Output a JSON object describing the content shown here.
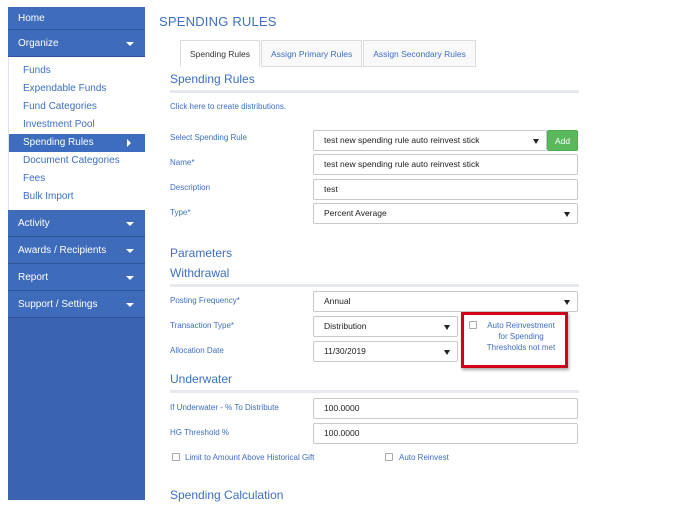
{
  "sidebar": {
    "home": "Home",
    "organize": "Organize",
    "organize_items": [
      "Funds",
      "Expendable Funds",
      "Fund Categories",
      "Investment Pool",
      "Spending Rules",
      "Document Categories",
      "Fees",
      "Bulk Import"
    ],
    "activity": "Activity",
    "awards": "Awards / Recipients",
    "report": "Report",
    "support": "Support / Settings"
  },
  "page": {
    "title": "SPENDING RULES"
  },
  "tabs": [
    "Spending Rules",
    "Assign Primary Rules",
    "Assign Secondary Rules"
  ],
  "spending_rules": {
    "heading": "Spending Rules",
    "create_link": "Click here to create distributions.",
    "select_label": "Select Spending Rule",
    "select_value": "test new spending rule auto reinvest stick",
    "add_button": "Add",
    "name_label": "Name*",
    "name_value": "test new spending rule auto reinvest stick",
    "description_label": "Description",
    "description_value": "test",
    "type_label": "Type*",
    "type_value": "Percent Average"
  },
  "parameters": {
    "heading": "Parameters"
  },
  "withdrawal": {
    "heading": "Withdrawal",
    "posting_frequency_label": "Posting Frequency*",
    "posting_frequency_value": "Annual",
    "transaction_type_label": "Transaction Type*",
    "transaction_type_value": "Distribution",
    "allocation_date_label": "Allocation Date",
    "allocation_date_value": "11/30/2019",
    "auto_reinvest_label": "Auto Reinvestment for Spending Thresholds not met"
  },
  "underwater": {
    "heading": "Underwater",
    "pct_label": "If Underwater - % To Distribute",
    "pct_value": "100.0000",
    "hg_label": "HG Threshold %",
    "hg_value": "100.0000",
    "limit_label": "Limit to Amount Above Historical Gift",
    "auto_reinvest_label": "Auto Reinvest"
  },
  "spending_calculation": {
    "heading": "Spending Calculation"
  }
}
